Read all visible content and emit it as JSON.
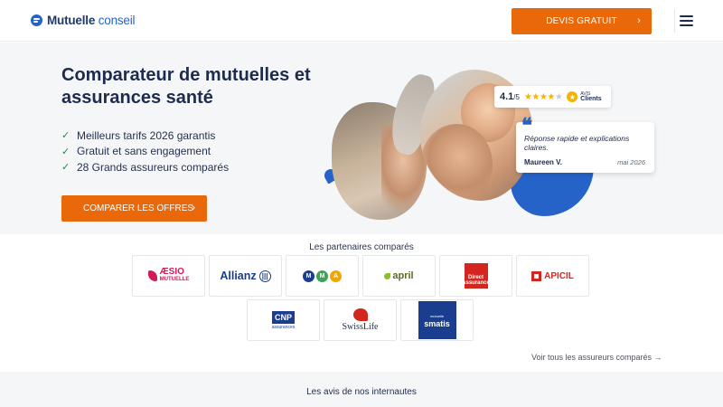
{
  "header": {
    "logo_main": "Mutuelle",
    "logo_accent": "conseil",
    "cta_label": "DEVIS GRATUIT",
    "chevron_icon": "chevron-right-icon",
    "menu_icon": "hamburger-icon"
  },
  "hero": {
    "title": "Comparateur de mutuelles et assurances santé",
    "benefits": [
      "Meilleurs tarifs 2026 garantis",
      "Gratuit et sans engagement",
      "28 Grands assureurs comparés"
    ],
    "cta_label": "COMPARER LES OFFRES"
  },
  "rating": {
    "score": "4.1",
    "scale": "/5",
    "stars_filled": 4,
    "stars_total": 5,
    "badge_line1": "AVIS",
    "badge_line2": "Clients"
  },
  "review": {
    "text": "Réponse rapide et explications claires.",
    "author": "Maureen V.",
    "date": "mai 2026"
  },
  "partners": {
    "title": "Les partenaires comparés",
    "logos": {
      "aesio_line1": "ÆSIO",
      "aesio_line2": "MUTUELLE",
      "allianz": "Allianz",
      "mma_letters": [
        "M",
        "M",
        "A"
      ],
      "april": "april",
      "direct_line1": "Direct",
      "direct_line2": "Assurance",
      "apicil": "APICIL",
      "cnp_line1": "CNP",
      "cnp_line2": "assurances",
      "swisslife": "SwissLife",
      "smatis_line1": "mutuelle",
      "smatis_line2": "smatis"
    },
    "see_all": "Voir tous les assureurs comparés →"
  },
  "reviews_section": {
    "title": "Les avis de nos internautes"
  },
  "colors": {
    "accent": "#e8680a",
    "brand": "#2563c9",
    "text": "#1d2b4f"
  }
}
